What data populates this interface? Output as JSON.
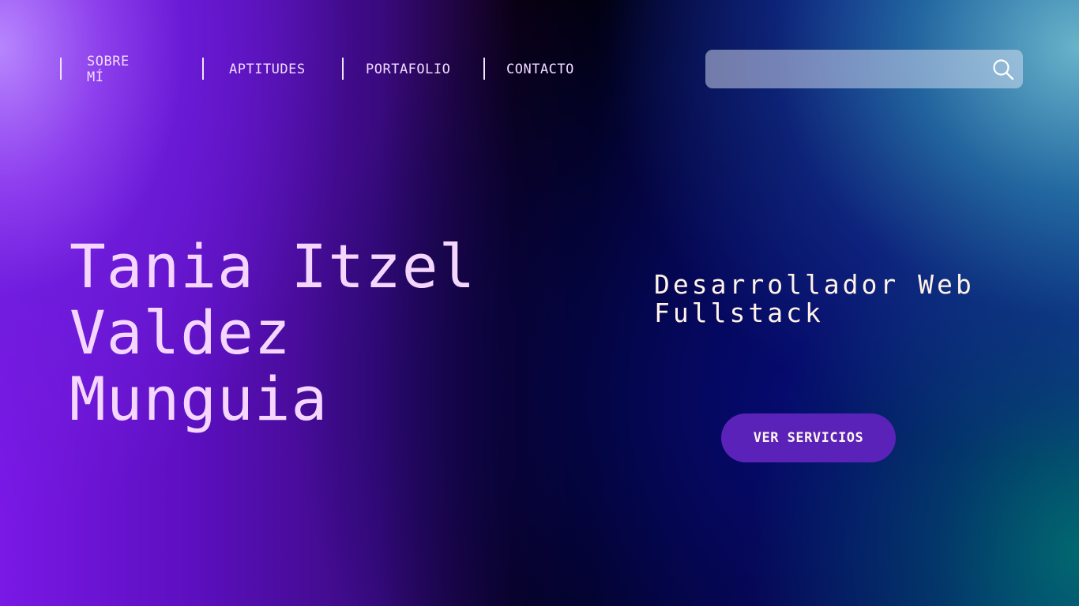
{
  "nav": {
    "items": [
      {
        "label": "SOBRE MÍ"
      },
      {
        "label": "APTITUDES"
      },
      {
        "label": "PORTAFOLIO"
      },
      {
        "label": "CONTACTO"
      }
    ]
  },
  "search": {
    "value": "",
    "placeholder": "",
    "icon": "search-icon"
  },
  "hero": {
    "name_lines": [
      "Tania Itzel",
      "Valdez",
      "Munguia"
    ],
    "role_lines": [
      "Desarrollador Web",
      "Fullstack"
    ],
    "cta_label": "VER SERVICIOS"
  },
  "colors": {
    "text_name": "#f4d6ff",
    "text_role": "#fff2e6",
    "cta_background": "#5a22b8",
    "nav_text": "#f2dcff"
  }
}
